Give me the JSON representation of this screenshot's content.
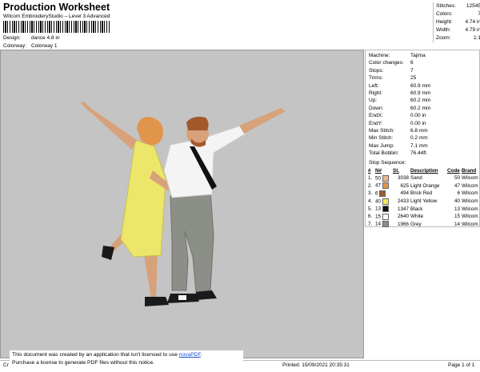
{
  "header": {
    "title": "Production Worksheet",
    "subtitle": "Wilcom EmbroideryStudio – Level 3 Advanced",
    "design_label": "Design:",
    "design_value": "dance 4.8 in",
    "colorway_label": "Colorway:",
    "colorway_value": "Colorway 1"
  },
  "stats": [
    {
      "label": "Stitches:",
      "value": "12545"
    },
    {
      "label": "Colors:",
      "value": "7"
    },
    {
      "label": "Height:",
      "value": "4.74 in"
    },
    {
      "label": "Width:",
      "value": "4.79 in"
    },
    {
      "label": "Zoom:",
      "value": "1:1"
    }
  ],
  "machine": [
    {
      "label": "Machine:",
      "value": "Tajima"
    },
    {
      "label": "Color changes:",
      "value": "6"
    },
    {
      "label": "Stops:",
      "value": "7"
    },
    {
      "label": "Trims:",
      "value": "25"
    },
    {
      "label": "Left:",
      "value": "60.9 mm"
    },
    {
      "label": "Right:",
      "value": "60.9 mm"
    },
    {
      "label": "Up:",
      "value": "60.2 mm"
    },
    {
      "label": "Down:",
      "value": "60.2 mm"
    },
    {
      "label": "EndX:",
      "value": "0.00 in"
    },
    {
      "label": "EndY:",
      "value": "0.00 in"
    },
    {
      "label": "Max Stitch:",
      "value": "6.8 mm"
    },
    {
      "label": "Min Stitch:",
      "value": "0.2 mm"
    },
    {
      "label": "Max Jump:",
      "value": "7.1 mm"
    },
    {
      "label": "Total Bobbin:",
      "value": "76.44ft"
    }
  ],
  "stop_sequence": {
    "title": "Stop Sequence:",
    "columns": [
      "#",
      "N#",
      "St.",
      "Description",
      "Code",
      "Brand"
    ],
    "rows": [
      {
        "n": "1.",
        "needle": "50",
        "color": "#e8b98a",
        "st": "3038",
        "desc": "Sand",
        "code": "50",
        "brand": "Wilcom"
      },
      {
        "n": "2.",
        "needle": "47",
        "color": "#e3953e",
        "st": "625",
        "desc": "Light Orange",
        "code": "47",
        "brand": "Wilcom"
      },
      {
        "n": "3.",
        "needle": "6",
        "color": "#9b5a2e",
        "st": "494",
        "desc": "Brick Red",
        "code": "6",
        "brand": "Wilcom"
      },
      {
        "n": "4.",
        "needle": "40",
        "color": "#f0ea5c",
        "st": "2433",
        "desc": "Light Yellow",
        "code": "40",
        "brand": "Wilcom"
      },
      {
        "n": "5.",
        "needle": "13",
        "color": "#111111",
        "st": "1347",
        "desc": "Black",
        "code": "13",
        "brand": "Wilcom"
      },
      {
        "n": "6.",
        "needle": "15",
        "color": "#ffffff",
        "st": "2640",
        "desc": "White",
        "code": "15",
        "brand": "Wilcom"
      },
      {
        "n": "7.",
        "needle": "14",
        "color": "#8c8c8c",
        "st": "1966",
        "desc": "Grey",
        "code": "14",
        "brand": "Wilcom"
      }
    ]
  },
  "footer": {
    "cr": "Cr",
    "printed": "Printed: 15/09/2021 20:35:31",
    "page": "Page 1 of 1"
  },
  "notice": {
    "line1_pre": "This document was created by an application that isn't licensed to use ",
    "link": "novaPDF",
    "line1_post": ".",
    "line2": "Purchase a license to generate PDF files without this notice."
  }
}
